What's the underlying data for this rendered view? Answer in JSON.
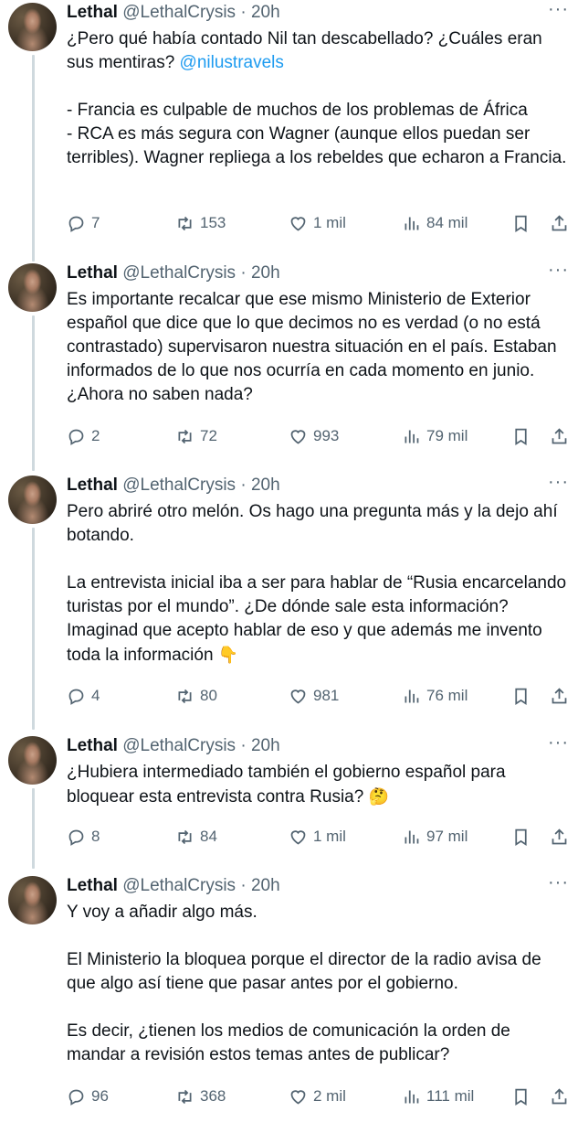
{
  "tweets": [
    {
      "name": "Lethal",
      "handle": "@LethalCrysis",
      "time": "· 20h",
      "lines": [
        {
          "text": "¿Pero qué había contado Nil tan descabellado? ¿Cuáles eran sus mentiras? ",
          "mention": "@nilustravels"
        },
        {
          "text": "- Francia es culpable de muchos de los problemas de África\n- RCA es más segura con Wagner (aunque ellos puedan ser terribles). Wagner repliega a los rebeldes que echaron a Francia."
        }
      ],
      "replies": "7",
      "retweets": "153",
      "likes": "1 mil",
      "views": "84 mil"
    },
    {
      "name": "Lethal",
      "handle": "@LethalCrysis",
      "time": "· 20h",
      "lines": [
        {
          "text": "Es importante recalcar que ese mismo Ministerio de Exterior español que dice que lo que decimos no es verdad (o no está contrastado) supervisaron nuestra situación en el país. Estaban informados de lo que nos ocurría en cada momento en junio. ¿Ahora no saben nada?"
        }
      ],
      "replies": "2",
      "retweets": "72",
      "likes": "993",
      "views": "79 mil"
    },
    {
      "name": "Lethal",
      "handle": "@LethalCrysis",
      "time": "· 20h",
      "lines": [
        {
          "text": "Pero abriré otro melón. Os hago una pregunta más y la dejo ahí botando."
        },
        {
          "text": "La entrevista inicial iba a ser para hablar de “Rusia encarcelando turistas por el mundo”. ¿De dónde sale esta información? Imaginad que acepto hablar de eso y que además me invento toda la información ",
          "emoji": "👇"
        }
      ],
      "replies": "4",
      "retweets": "80",
      "likes": "981",
      "views": "76 mil"
    },
    {
      "name": "Lethal",
      "handle": "@LethalCrysis",
      "time": "· 20h",
      "lines": [
        {
          "text": "¿Hubiera intermediado también el gobierno español para bloquear esta entrevista contra Rusia? ",
          "emoji": "🤔"
        }
      ],
      "replies": "8",
      "retweets": "84",
      "likes": "1 mil",
      "views": "97 mil"
    },
    {
      "name": "Lethal",
      "handle": "@LethalCrysis",
      "time": "· 20h",
      "lines": [
        {
          "text": "Y voy a añadir algo más."
        },
        {
          "text": "El Ministerio la bloquea porque el director de la radio avisa de que algo así tiene que pasar antes por el gobierno."
        },
        {
          "text": "Es decir, ¿tienen los medios de comunicación la orden de mandar a revisión estos temas antes de publicar?"
        }
      ],
      "replies": "96",
      "retweets": "368",
      "likes": "2 mil",
      "views": "111 mil"
    }
  ],
  "icons": {
    "reply": "reply-icon",
    "retweet": "retweet-icon",
    "like": "heart-icon",
    "views": "views-icon",
    "bookmark": "bookmark-icon",
    "share": "share-icon",
    "more": "more-icon"
  },
  "colors": {
    "text": "#0f1419",
    "muted": "#536471",
    "link": "#1d9bf0",
    "thread": "#cfd9de"
  }
}
